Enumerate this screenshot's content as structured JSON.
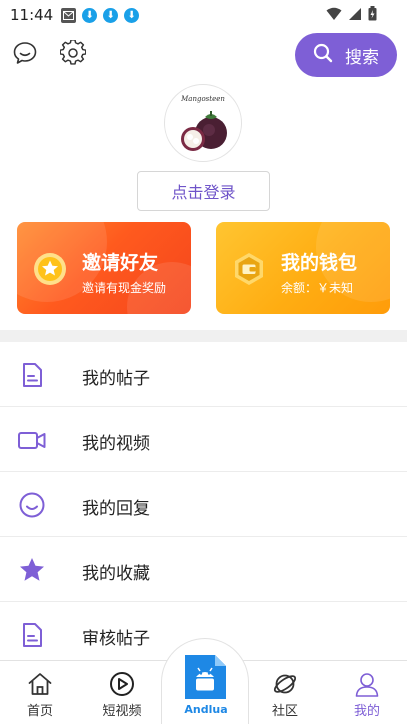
{
  "status_bar": {
    "time": "11:44"
  },
  "header": {
    "search_label": "搜索"
  },
  "profile": {
    "avatar_caption": "Mangosteen",
    "login_label": "点击登录"
  },
  "cards": {
    "invite": {
      "title": "邀请好友",
      "subtitle": "邀请有现金奖励"
    },
    "wallet": {
      "title": "我的钱包",
      "subtitle": "余额：￥未知"
    }
  },
  "menu": [
    {
      "label": "我的帖子",
      "icon": "document-icon"
    },
    {
      "label": "我的视频",
      "icon": "video-camera-icon"
    },
    {
      "label": "我的回复",
      "icon": "smiley-icon"
    },
    {
      "label": "我的收藏",
      "icon": "star-icon"
    },
    {
      "label": "审核帖子",
      "icon": "document-icon"
    }
  ],
  "bottom_nav": {
    "home": "首页",
    "short_video": "短视频",
    "center": "Andlua",
    "community": "社区",
    "mine": "我的"
  },
  "colors": {
    "accent": "#7e5fd6",
    "invite_card": "#ff5a1e",
    "wallet_card": "#ffad12",
    "center_blue": "#1e88e5"
  }
}
